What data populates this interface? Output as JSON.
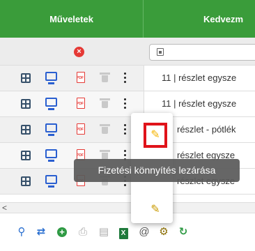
{
  "header": {
    "col_actions": "Műveletek",
    "col_discount": "Kedvezm"
  },
  "filter": {
    "clear_icon": "close-circle-icon",
    "input_value": ""
  },
  "rows": [
    {
      "text": "11 | részlet egysze"
    },
    {
      "text": "11 | részlet egysze"
    },
    {
      "text": "részlet - pótlék"
    },
    {
      "text": "részlet egysze"
    },
    {
      "text": "részlet egysze"
    }
  ],
  "popup": {
    "item1_icon": "pencil-lock-icon",
    "item2_icon": "pencil-w-icon",
    "tooltip": "Fizetési könnyítés lezárása"
  },
  "toolbar": {
    "icons": [
      "search-icon",
      "retweet-icon",
      "add-icon",
      "print-icon",
      "document-icon",
      "excel-icon",
      "at-icon",
      "settings-icon",
      "refresh-icon"
    ]
  },
  "colors": {
    "header_bg": "#3a9c3a",
    "highlight": "#e0131a",
    "tooltip_bg": "#5a5a5a"
  }
}
